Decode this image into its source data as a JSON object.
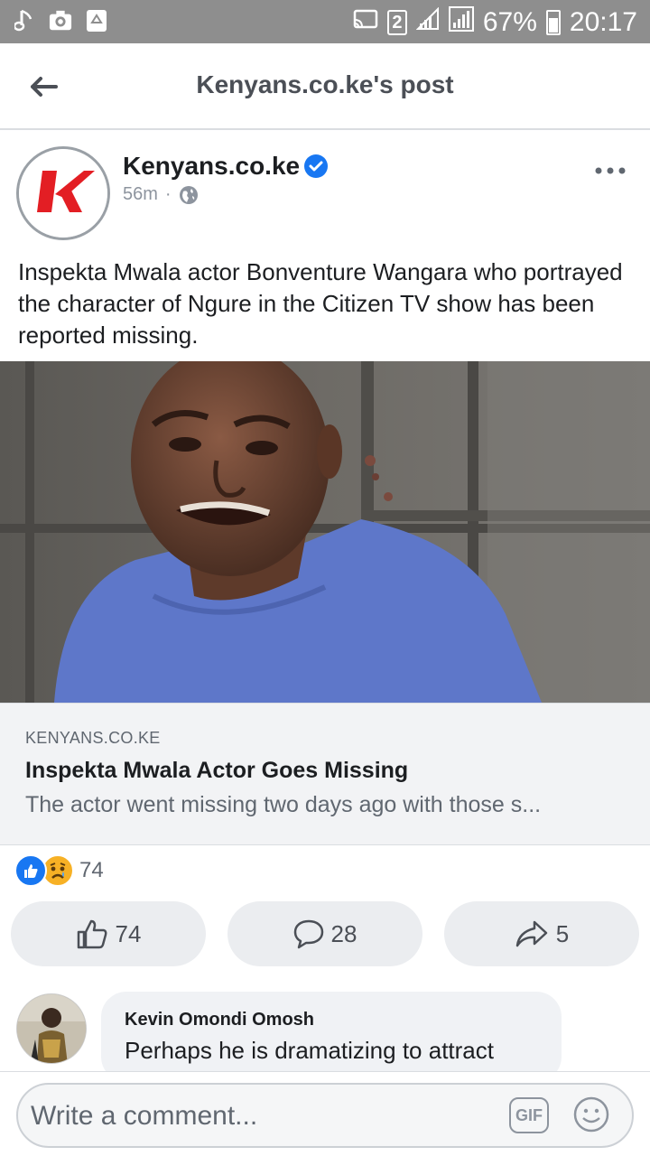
{
  "status_bar": {
    "battery": "67%",
    "time": "20:17",
    "sim_number": "2",
    "left_icons": [
      "music-note-icon",
      "camera-icon",
      "recycle-icon"
    ],
    "right_icons": [
      "cast-icon",
      "sim-icon",
      "signal-icon",
      "signal-icon",
      "battery-icon"
    ],
    "battery_level": 0.67
  },
  "header": {
    "title": "Kenyans.co.ke's post",
    "back_icon": "back-arrow-icon"
  },
  "post": {
    "page_name": "Kenyans.co.ke",
    "verified": true,
    "time": "56m",
    "separator": "·",
    "privacy_icon": "globe-icon",
    "text": "Inspekta Mwala actor Bonventure Wangara who portrayed the character of Ngure in the Citizen TV show has been reported missing.",
    "more_icon": "more-dots-icon"
  },
  "link_preview": {
    "domain": "KENYANS.CO.KE",
    "title": "Inspekta Mwala Actor Goes Missing",
    "description": "The actor went missing two days ago with those s..."
  },
  "reactions": {
    "types": [
      "like",
      "sad"
    ],
    "count": "74"
  },
  "actions": {
    "like_count": "74",
    "comment_count": "28",
    "share_count": "5"
  },
  "comment": {
    "author": "Kevin Omondi Omosh",
    "text": "Perhaps he is dramatizing to attract"
  },
  "composer": {
    "placeholder": "Write a comment...",
    "gif_label": "GIF"
  },
  "colors": {
    "status_bar": "#8e8e8e",
    "facebook_blue": "#1877f2",
    "brand_red": "#e31e24",
    "sad_yellow": "#f7b125"
  }
}
